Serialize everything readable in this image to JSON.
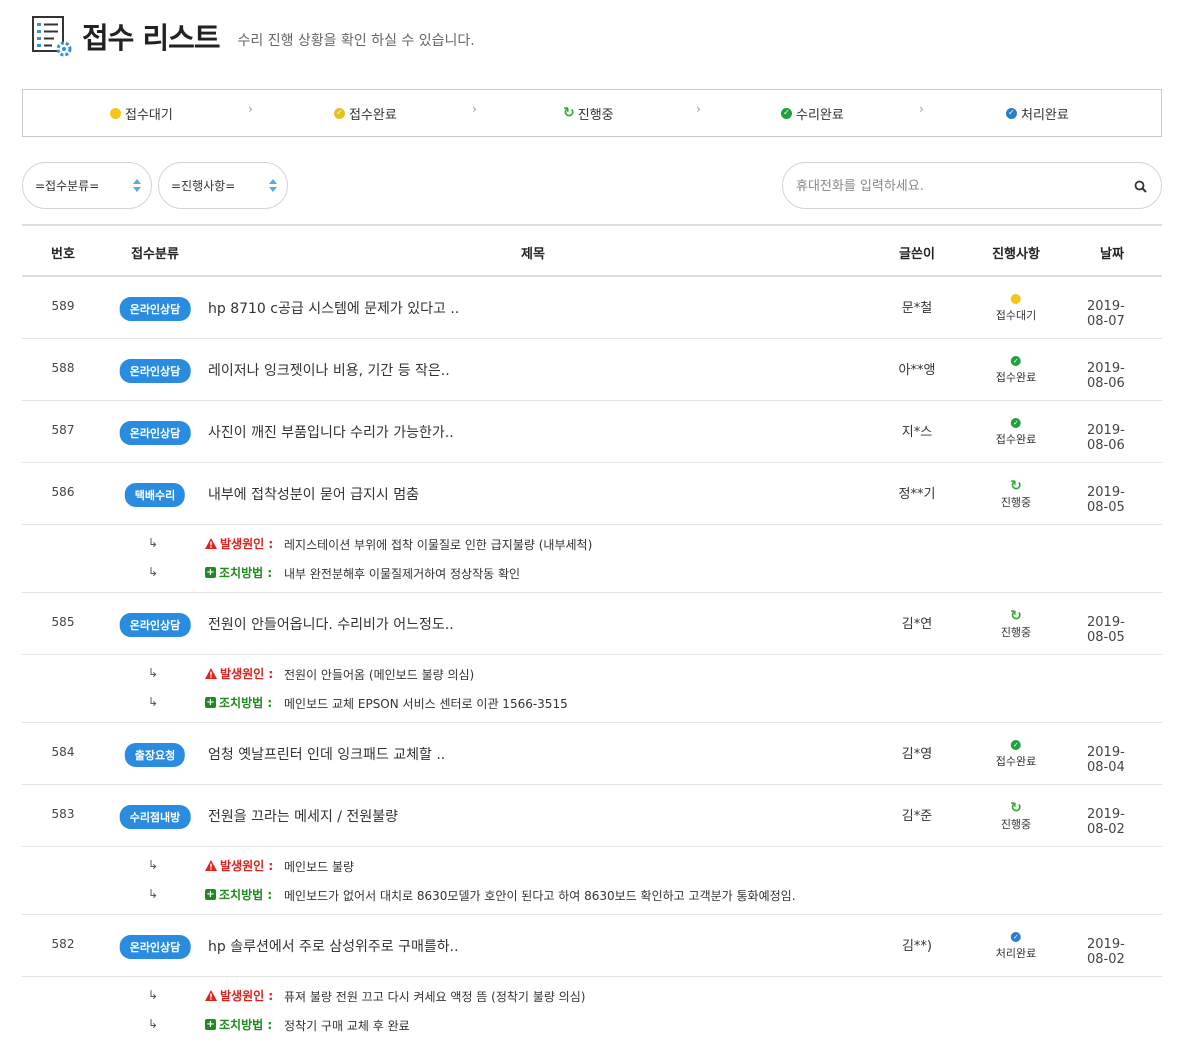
{
  "header": {
    "title": "접수 리스트",
    "subtitle": "수리 진행 상황을 확인 하실 수 있습니다.",
    "icon": "checklist-gear-icon"
  },
  "colors": {
    "waiting": "#f5c518",
    "received": "#e8c020",
    "progress": "#2eaa2e",
    "repaired": "#22a040",
    "processed": "#2a7fc9",
    "badge": "#2a8ce0",
    "cause": "#e0201e",
    "action": "#1f8a1f"
  },
  "steps": [
    "접수대기",
    "접수완료",
    "진행중",
    "수리완료",
    "처리완료"
  ],
  "filters": {
    "category": "=접수분류=",
    "status": "=진행사항=",
    "search_placeholder": "휴대전화를 입력하세요."
  },
  "table": {
    "headers": {
      "num": "번호",
      "category": "접수분류",
      "title": "제목",
      "writer": "글쓴이",
      "status": "진행사항",
      "date": "날짜"
    },
    "labels": {
      "cause": "발생원인 :",
      "action": "조치방법 :",
      "return": "↳"
    },
    "rows": [
      {
        "num": "589",
        "category": "온라인상담",
        "title": "hp 8710 c공급 시스템에 문제가 있다고 ..",
        "writer": "문*철",
        "status": "접수대기",
        "date": "2019-08-07"
      },
      {
        "num": "588",
        "category": "온라인상담",
        "title": "레이저나 잉크젯이나 비용, 기간 등 작은..",
        "writer": "아**앵",
        "status": "접수완료",
        "date": "2019-08-06"
      },
      {
        "num": "587",
        "category": "온라인상담",
        "title": "사진이 깨진 부품입니다 수리가 가능한가..",
        "writer": "지*스",
        "status": "접수완료",
        "date": "2019-08-06"
      },
      {
        "num": "586",
        "category": "택배수리",
        "title": "내부에 접착성분이 묻어 급지시 멈춤",
        "writer": "정**기",
        "status": "진행중",
        "date": "2019-08-05",
        "cause": "레지스테이션 부위에 접착 이물질로 인한 급지불량 (내부세척)",
        "action": "내부 완전분해후 이물질제거하여 정상작동 확인"
      },
      {
        "num": "585",
        "category": "온라인상담",
        "title": "전원이 안들어옵니다. 수리비가 어느정도..",
        "writer": "김*연",
        "status": "진행중",
        "date": "2019-08-05",
        "cause": "전원이 안들어옴 (메인보드 불량 의심)",
        "action": "메인보드 교체 EPSON 서비스 센터로 이관 1566-3515"
      },
      {
        "num": "584",
        "category": "출장요청",
        "title": "엄청 옛날프린터 인데 잉크패드 교체할 ..",
        "writer": "김*영",
        "status": "접수완료",
        "date": "2019-08-04"
      },
      {
        "num": "583",
        "category": "수리점내방",
        "title": "전원을 끄라는 메세지 / 전원불량",
        "writer": "김*준",
        "status": "진행중",
        "date": "2019-08-02",
        "cause": "메인보드 불량",
        "action": "메인보드가 없어서 대치로 8630모델가 호안이 된다고 하여 8630보드 확인하고 고객분가 통화예정임."
      },
      {
        "num": "582",
        "category": "온라인상담",
        "title": "hp 솔루션에서 주로 삼성위주로 구매를하..",
        "writer": "김**)",
        "status": "처리완료",
        "date": "2019-08-02",
        "cause": "퓨져 불량 전원 끄고 다시 켜세요 액정 뜸 (정착기 불량 의심)",
        "action": "정착기 구매 교체 후 완료"
      }
    ]
  }
}
